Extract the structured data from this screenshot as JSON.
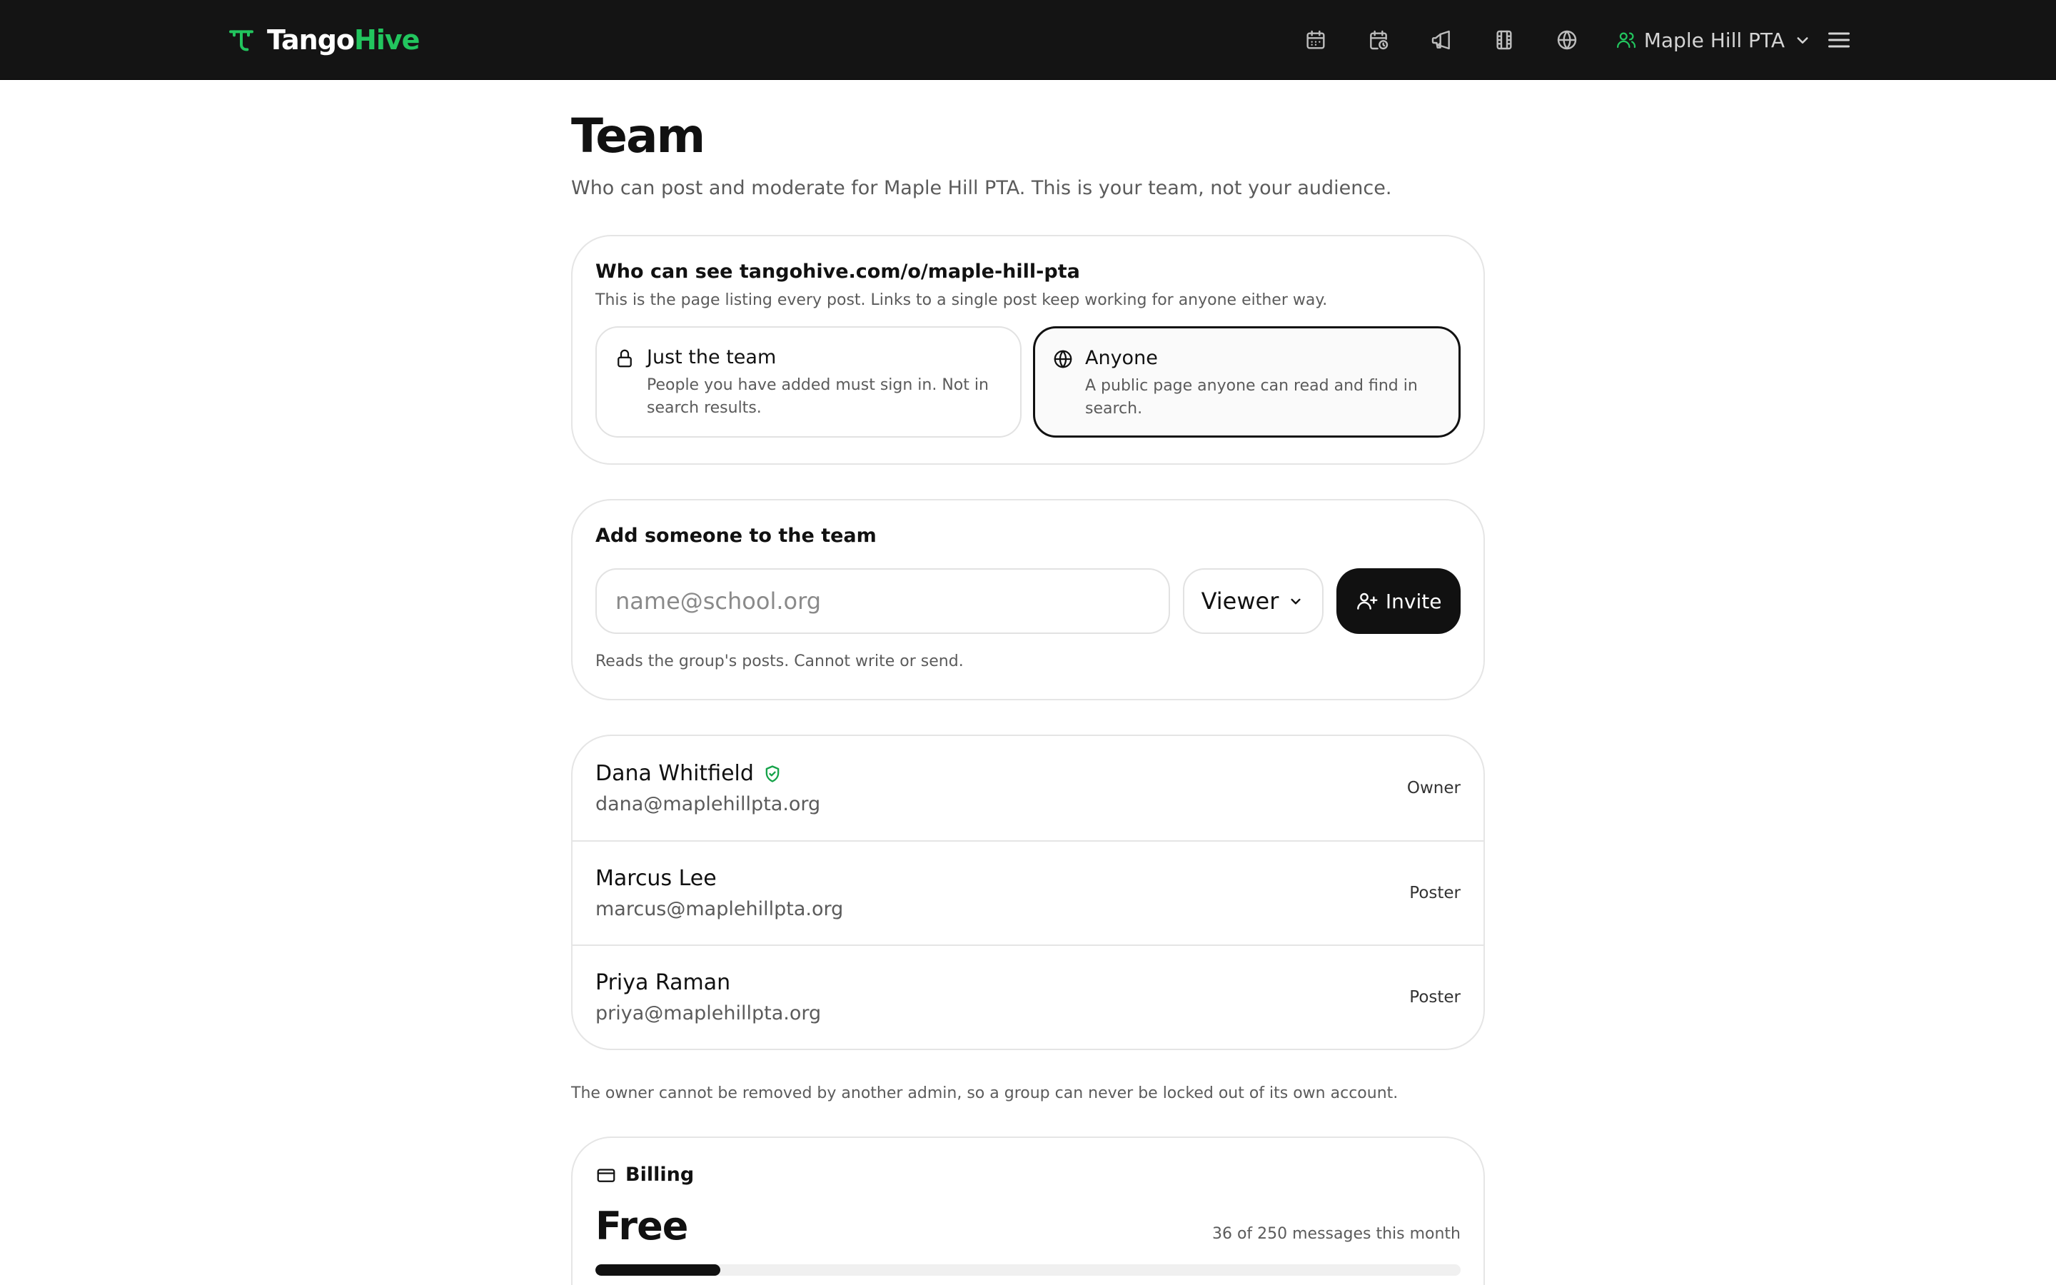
{
  "brand": {
    "name_part1": "Tango",
    "name_part2": "Hive",
    "accent_color": "#22c55e"
  },
  "nav": {
    "icons": [
      "calendar-icon",
      "calendar-clock-icon",
      "megaphone-icon",
      "film-icon",
      "globe-icon"
    ],
    "org_label": "Maple Hill PTA"
  },
  "page": {
    "title": "Team",
    "subtitle": "Who can post and moderate for Maple Hill PTA. This is your team, not your audience."
  },
  "visibility": {
    "title": "Who can see tangohive.com/o/maple-hill-pta",
    "description": "This is the page listing every post. Links to a single post keep working for anyone either way.",
    "options": [
      {
        "title": "Just the team",
        "description": "People you have added must sign in. Not in search results.",
        "icon": "lock-icon",
        "selected": false
      },
      {
        "title": "Anyone",
        "description": "A public page anyone can read and find in search.",
        "icon": "globe-icon",
        "selected": true
      }
    ]
  },
  "invite": {
    "title": "Add someone to the team",
    "email_placeholder": "name@school.org",
    "email_value": "",
    "role_value": "Viewer",
    "button_label": "Invite",
    "role_hint": "Reads the group's posts. Cannot write or send."
  },
  "members": [
    {
      "name": "Dana Whitfield",
      "email": "dana@maplehillpta.org",
      "role": "Owner",
      "verified": true
    },
    {
      "name": "Marcus Lee",
      "email": "marcus@maplehillpta.org",
      "role": "Poster",
      "verified": false
    },
    {
      "name": "Priya Raman",
      "email": "priya@maplehillpta.org",
      "role": "Poster",
      "verified": false
    }
  ],
  "owner_note": "The owner cannot be removed by another admin, so a group can never be locked out of its own account.",
  "billing": {
    "label": "Billing",
    "plan": "Free",
    "usage_text": "36 of 250 messages this month",
    "used": 36,
    "limit": 250
  }
}
